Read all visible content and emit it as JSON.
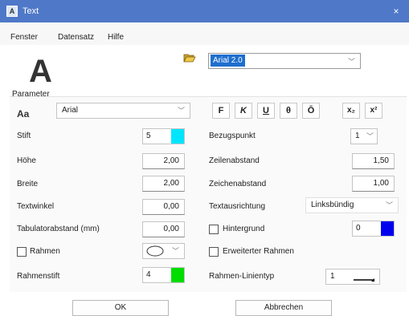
{
  "window": {
    "title": "Text",
    "close_glyph": "×"
  },
  "menu": [
    "Fenster",
    "Datensatz",
    "Hilfe"
  ],
  "preview": {
    "letter": "A"
  },
  "font_file": {
    "selected": "Arial 2.0"
  },
  "parameter": {
    "group_label": "Parameter",
    "aa_label": "Aa",
    "font_name": "Arial",
    "format_buttons": [
      "F",
      "K",
      "U",
      "θ",
      "Ō",
      "x₂",
      "x²"
    ],
    "stift": {
      "label": "Stift",
      "value": "5",
      "color": "#00e5ff"
    },
    "hoehe": {
      "label": "Höhe",
      "value": "2,00"
    },
    "breite": {
      "label": "Breite",
      "value": "2,00"
    },
    "textwinkel": {
      "label": "Textwinkel",
      "value": "0,00"
    },
    "tabulator": {
      "label": "Tabulatorabstand (mm)",
      "value": "0,00"
    },
    "rahmen": {
      "label": "Rahmen"
    },
    "rahmenstift": {
      "label": "Rahmenstift",
      "value": "4",
      "color": "#00dd00"
    },
    "bezugspunkt": {
      "label": "Bezugspunkt",
      "value": "1"
    },
    "zeilenabstand": {
      "label": "Zeilenabstand",
      "value": "1,50"
    },
    "zeichenabstand": {
      "label": "Zeichenabstand",
      "value": "1,00"
    },
    "textausrichtung": {
      "label": "Textausrichtung",
      "value": "Linksbündig"
    },
    "hintergrund": {
      "label": "Hintergrund",
      "value": "0",
      "color": "#0000ee"
    },
    "erweiterter_rahmen": {
      "label": "Erweiterter Rahmen"
    },
    "rahmen_linientyp": {
      "label": "Rahmen-Linientyp",
      "value": "1"
    }
  },
  "buttons": {
    "ok": "OK",
    "cancel": "Abbrechen"
  }
}
